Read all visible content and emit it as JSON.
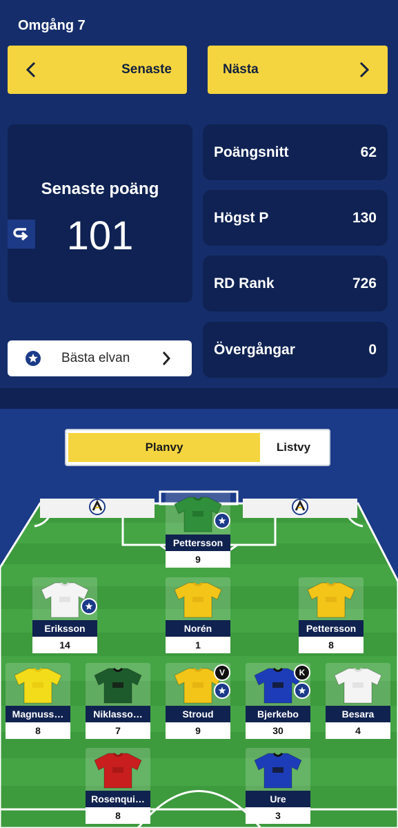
{
  "round": {
    "title": "Omgång 7"
  },
  "nav": {
    "prev_label": "Senaste",
    "next_label": "Nästa"
  },
  "latest": {
    "label": "Senaste poäng",
    "value": "101"
  },
  "stats": [
    {
      "label": "Poängsnitt",
      "value": "62"
    },
    {
      "label": "Högst P",
      "value": "130"
    },
    {
      "label": "RD Rank",
      "value": "726"
    },
    {
      "label": "Övergångar",
      "value": "0"
    }
  ],
  "best": {
    "label": "Bästa elvan"
  },
  "view_toggle": {
    "pitch": "Planvy",
    "list": "Listvy"
  },
  "colors": {
    "accent": "#f5d53f",
    "navy": "#0f2253",
    "pitch": "#3f9a3f"
  },
  "players": [
    {
      "name": "Pettersson",
      "points": "9",
      "shirt": "#2f8f3a",
      "accent": "#1f6e2a",
      "star": true,
      "role": ""
    },
    {
      "name": "Eriksson",
      "points": "14",
      "shirt": "#f4f4f4",
      "accent": "#dcdcdc",
      "star": true,
      "role": ""
    },
    {
      "name": "Norén",
      "points": "1",
      "shirt": "#f3c518",
      "accent": "#e0ae10",
      "star": false,
      "role": ""
    },
    {
      "name": "Pettersson",
      "points": "8",
      "shirt": "#f3c518",
      "accent": "#e0ae10",
      "star": false,
      "role": ""
    },
    {
      "name": "Magnuss…",
      "points": "8",
      "shirt": "#f3dc1a",
      "accent": "#e7c60e",
      "star": false,
      "role": ""
    },
    {
      "name": "Niklasso…",
      "points": "7",
      "shirt": "#1e5b2c",
      "accent": "#111111",
      "star": false,
      "role": ""
    },
    {
      "name": "Stroud",
      "points": "9",
      "shirt": "#f3c518",
      "accent": "#e0ae10",
      "star": true,
      "role": "V"
    },
    {
      "name": "Bjerkebo",
      "points": "30",
      "shirt": "#1d3db8",
      "accent": "#111111",
      "star": true,
      "role": "K"
    },
    {
      "name": "Besara",
      "points": "4",
      "shirt": "#f4f4f4",
      "accent": "#dcdcdc",
      "star": false,
      "role": ""
    },
    {
      "name": "Rosenqui…",
      "points": "8",
      "shirt": "#c81e1e",
      "accent": "#9d1414",
      "star": false,
      "role": ""
    },
    {
      "name": "Ure",
      "points": "3",
      "shirt": "#1d3db8",
      "accent": "#111111",
      "star": false,
      "role": ""
    }
  ]
}
